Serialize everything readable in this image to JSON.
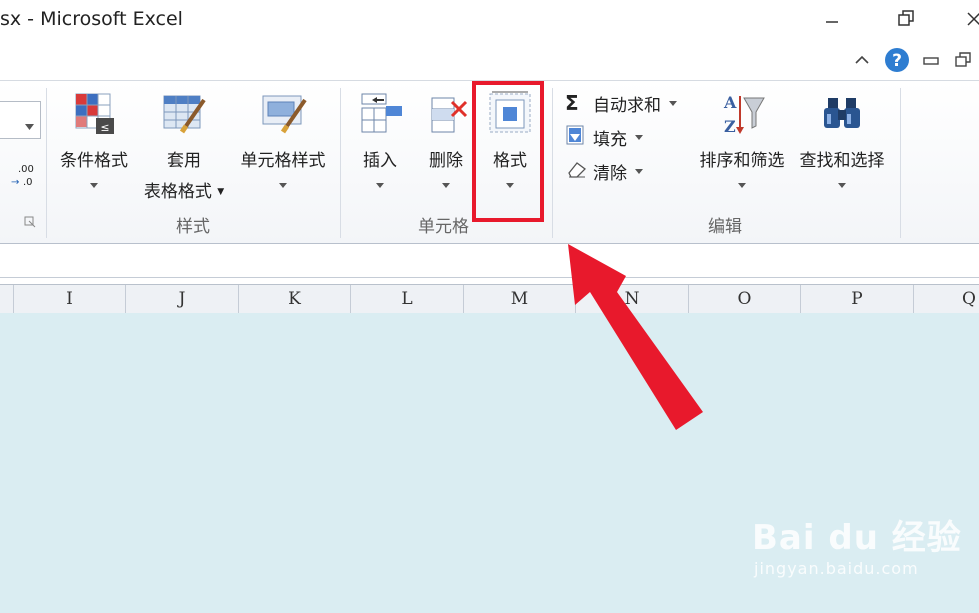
{
  "window": {
    "title": "sx  -  Microsoft Excel",
    "minimize_icon": "minimize-icon",
    "restore_icon": "restore-icon",
    "close_icon": "close-icon"
  },
  "subbar": {
    "help_icon": "help-icon"
  },
  "ribbon": {
    "number_group": {
      "decrease_decimal_label": ".00\n→.0"
    },
    "styles_group": {
      "label": "样式",
      "conditional_format": "条件格式",
      "format_as_table_1": "套用",
      "format_as_table_2": "表格格式",
      "cell_styles": "单元格样式"
    },
    "cells_group": {
      "label": "单元格",
      "insert": "插入",
      "delete": "删除",
      "format": "格式"
    },
    "editing_group": {
      "label": "编辑",
      "autosum": "自动求和",
      "fill": "填充",
      "clear": "清除",
      "sort_filter": "排序和筛选",
      "find_select": "查找和选择"
    }
  },
  "columns": [
    "I",
    "J",
    "K",
    "L",
    "M",
    "N",
    "O",
    "P",
    "Q"
  ],
  "watermark": {
    "main": "Bai du 经验",
    "sub": "jingyan.baidu.com"
  },
  "colors": {
    "highlight": "#e8192c",
    "sheet_bg": "#daedf2",
    "arrow": "#e8192c"
  }
}
